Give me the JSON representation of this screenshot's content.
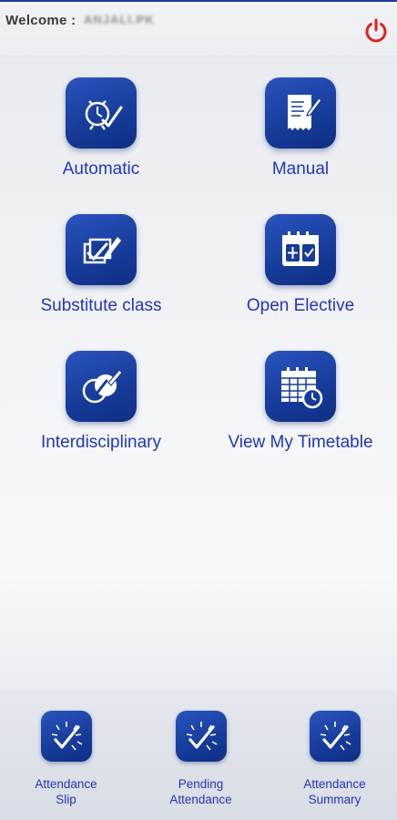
{
  "header": {
    "welcome_label": "Welcome :",
    "username": "ANJALI.PK",
    "power_icon": "power-icon",
    "accent_color": "#e02020"
  },
  "menu": [
    {
      "label": "Automatic",
      "icon": "clock-check-icon"
    },
    {
      "label": "Manual",
      "icon": "document-pen-icon"
    },
    {
      "label": "Substitute class",
      "icon": "pages-pencil-icon"
    },
    {
      "label": "Open Elective",
      "icon": "calendar-grid-icon"
    },
    {
      "label": "Interdisciplinary",
      "icon": "circles-pen-icon"
    },
    {
      "label": "View My Timetable",
      "icon": "calendar-clock-icon"
    }
  ],
  "bottom_nav": [
    {
      "line1": "Attendance",
      "line2": "Slip",
      "icon": "sparkle-check-icon"
    },
    {
      "line1": "Pending",
      "line2": "Attendance",
      "icon": "sparkle-check-icon"
    },
    {
      "line1": "Attendance",
      "line2": "Summary",
      "icon": "sparkle-check-icon"
    }
  ],
  "colors": {
    "brand_blue": "#1a3f9e",
    "label_blue": "#2336b8"
  }
}
